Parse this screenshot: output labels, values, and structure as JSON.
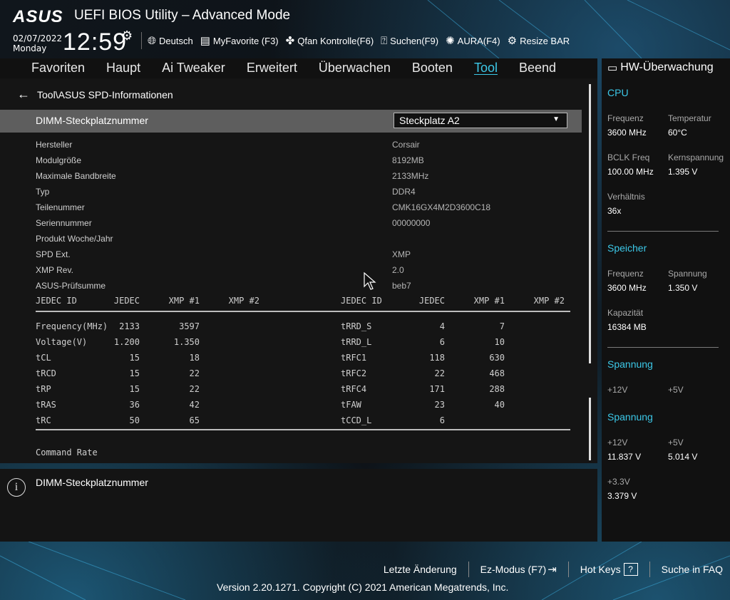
{
  "header": {
    "logo": "ASUS",
    "title": "UEFI BIOS Utility – Advanced Mode",
    "date": "02/07/2022",
    "weekday": "Monday",
    "time": "12:59",
    "toolbar": [
      {
        "label": "Deutsch",
        "icon": "globe-icon"
      },
      {
        "label": "MyFavorite (F3)",
        "icon": "favorite-icon"
      },
      {
        "label": "Qfan Kontrolle(F6)",
        "icon": "fan-icon"
      },
      {
        "label": "Suchen(F9)",
        "icon": "search-help-icon"
      },
      {
        "label": "AURA(F4)",
        "icon": "aura-icon"
      },
      {
        "label": "Resize BAR",
        "icon": "resize-bar-icon"
      }
    ]
  },
  "nav": {
    "tabs": [
      "Favoriten",
      "Haupt",
      "Ai Tweaker",
      "Erweitert",
      "Überwachen",
      "Booten",
      "Tool",
      "Beend"
    ],
    "active": "Tool"
  },
  "main": {
    "breadcrumb": "Tool\\ASUS SPD-Informationen",
    "dimm_label": "DIMM-Steckplatznummer",
    "dimm_value": "Steckplatz A2",
    "info": [
      {
        "key": "Hersteller",
        "value": "Corsair"
      },
      {
        "key": "Modulgröße",
        "value": "8192MB"
      },
      {
        "key": "Maximale Bandbreite",
        "value": "2133MHz"
      },
      {
        "key": "Typ",
        "value": "DDR4"
      },
      {
        "key": "Teilenummer",
        "value": "CMK16GX4M2D3600C18"
      },
      {
        "key": "Seriennummer",
        "value": "00000000"
      },
      {
        "key": "Produkt Woche/Jahr",
        "value": ""
      },
      {
        "key": "SPD Ext.",
        "value": "XMP"
      },
      {
        "key": "XMP Rev.",
        "value": "2.0"
      },
      {
        "key": "ASUS-Prüfsumme",
        "value": "beb7"
      }
    ],
    "timing_headers": [
      "JEDEC ID",
      "JEDEC",
      "XMP #1",
      "XMP #2",
      "JEDEC ID",
      "JEDEC",
      "XMP #1",
      "XMP #2"
    ],
    "timing_rows": [
      [
        "Frequency(MHz)",
        "2133",
        "3597",
        "",
        "tRRD_S",
        "4",
        "7",
        ""
      ],
      [
        "Voltage(V)",
        "1.200",
        "1.350",
        "",
        "tRRD_L",
        "6",
        "10",
        ""
      ],
      [
        "tCL",
        "15",
        "18",
        "",
        "tRFC1",
        "118",
        "630",
        ""
      ],
      [
        "tRCD",
        "15",
        "22",
        "",
        "tRFC2",
        "22",
        "468",
        ""
      ],
      [
        "tRP",
        "15",
        "22",
        "",
        "tRFC4",
        "171",
        "288",
        ""
      ],
      [
        "tRAS",
        "36",
        "42",
        "",
        "tFAW",
        "23",
        "40",
        ""
      ],
      [
        "tRC",
        "50",
        "65",
        "",
        "tCCD_L",
        "6",
        "",
        ""
      ]
    ],
    "command_rate_label": "Command Rate"
  },
  "help": {
    "text": "DIMM-Steckplatznummer"
  },
  "hw": {
    "title": "HW-Überwachung",
    "cpu": {
      "section": "CPU",
      "freq_label": "Frequenz",
      "freq_value": "3600 MHz",
      "temp_label": "Temperatur",
      "temp_value": "60°C",
      "bclk_label": "BCLK Freq",
      "bclk_value": "100.00 MHz",
      "core_label": "Kernspannung",
      "core_value": "1.395 V",
      "ratio_label": "Verhältnis",
      "ratio_value": "36x"
    },
    "memory": {
      "section": "Speicher",
      "freq_label": "Frequenz",
      "freq_value": "3600 MHz",
      "volt_label": "Spannung",
      "volt_value": "1.350 V",
      "cap_label": "Kapazität",
      "cap_value": "16384 MB"
    },
    "voltage1": {
      "section": "Spannung",
      "v12_label": "+12V",
      "v5_label": "+5V"
    },
    "voltage2": {
      "section": "Spannung",
      "v12_label": "+12V",
      "v12_value": "11.837 V",
      "v5_label": "+5V",
      "v5_value": "5.014 V",
      "v33_label": "+3.3V",
      "v33_value": "3.379 V"
    }
  },
  "footer": {
    "last_change": "Letzte Änderung",
    "ez_mode": "Ez-Modus (F7)",
    "hot_keys": "Hot Keys",
    "hot_keys_box": "?",
    "faq": "Suche in FAQ",
    "version": "Version 2.20.1271. Copyright (C) 2021 American Megatrends, Inc."
  },
  "colors": {
    "accent": "#3cc8e8",
    "selected_row": "#5e5e5e",
    "panel": "#151515"
  }
}
